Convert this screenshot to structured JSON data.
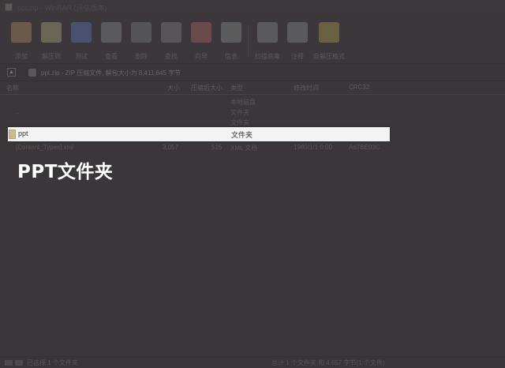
{
  "window": {
    "title": "ppt.zip - WinRAR (评估版本)"
  },
  "toolbar": {
    "buttons": [
      {
        "label": "添加",
        "icon": "add-archive-icon",
        "color": "#6a5a4a"
      },
      {
        "label": "解压到",
        "icon": "extract-to-icon",
        "color": "#6a6656"
      },
      {
        "label": "测试",
        "icon": "test-icon",
        "color": "#4a5070"
      },
      {
        "label": "查看",
        "icon": "view-icon",
        "color": "#5a5a5e"
      },
      {
        "label": "删除",
        "icon": "delete-icon",
        "color": "#555557"
      },
      {
        "label": "查找",
        "icon": "find-icon",
        "color": "#575557"
      },
      {
        "label": "向导",
        "icon": "wizard-icon",
        "color": "#6a4a4a"
      },
      {
        "label": "信息",
        "icon": "info-icon",
        "color": "#5c5c5c"
      },
      {
        "label": "扫描病毒",
        "icon": "virus-scan-icon",
        "color": "#5a5a5c"
      },
      {
        "label": "注释",
        "icon": "comment-icon",
        "color": "#5a5a5e"
      },
      {
        "label": "自解压格式",
        "icon": "sfx-icon",
        "color": "#6a6044"
      }
    ]
  },
  "address": {
    "path": "ppt.zip - ZIP 压缩文件, 解包大小为 8,411,845 字节"
  },
  "columns": [
    "名称",
    "大小",
    "压缩后大小",
    "类型",
    "修改时间",
    "CRC32"
  ],
  "rows": [
    {
      "name": "",
      "size": "",
      "packed": "",
      "type": "本地磁盘",
      "modified": "",
      "crc": ""
    },
    {
      "name": "..",
      "size": "",
      "packed": "",
      "type": "文件夹",
      "modified": "",
      "crc": ""
    },
    {
      "name": "",
      "size": "",
      "packed": "",
      "type": "文件夹",
      "modified": "",
      "crc": ""
    }
  ],
  "selected": {
    "name": "ppt",
    "type": "文件夹"
  },
  "below_row": {
    "name": "[Content_Types].xml",
    "size": "3,057",
    "packed": "515",
    "type": "XML 文档",
    "modified": "1980/1/1 0:00",
    "crc": "A67BE03C"
  },
  "caption": "PPT文件夹",
  "status": {
    "left": "已选择 1 个文件夹",
    "right": "总计 1 个文件夹 和 4,657 字节(1 个文件)"
  }
}
